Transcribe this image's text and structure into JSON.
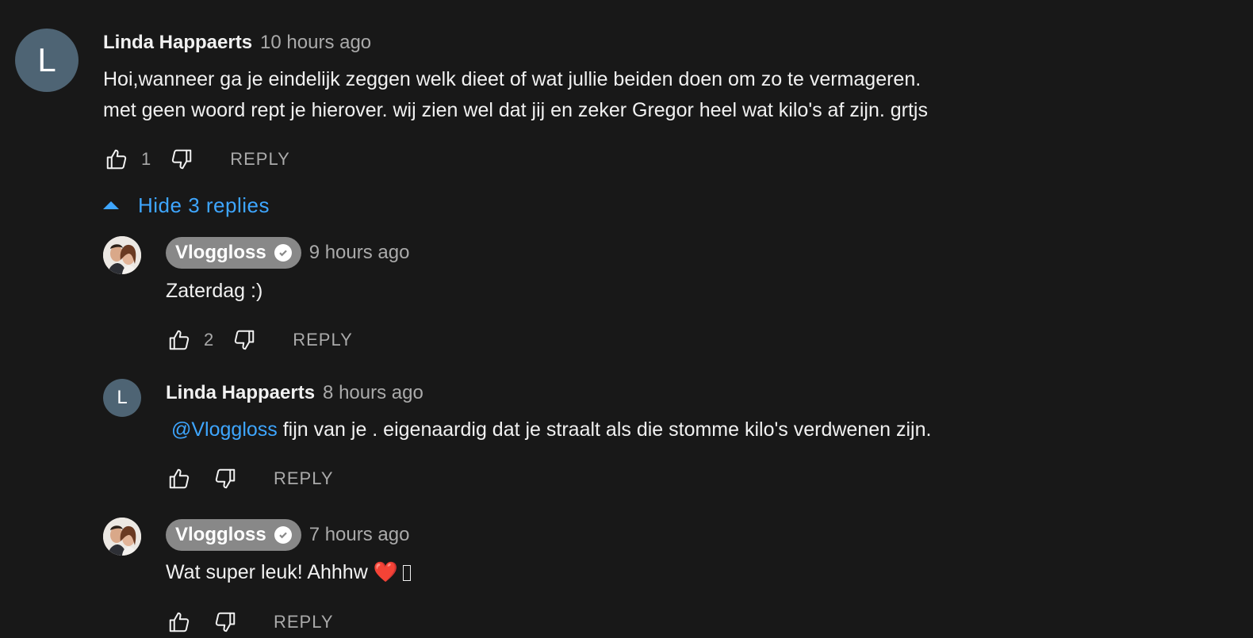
{
  "comments": [
    {
      "avatar_letter": "L",
      "author": "Linda Happaerts",
      "time": "10 hours ago",
      "lines": [
        "Hoi,wanneer ga je eindelijk zeggen welk dieet of wat  jullie beiden doen om zo te vermageren.",
        "met geen woord rept je hierover. wij zien wel dat jij en zeker Gregor heel wat kilo's  af zijn.  grtjs"
      ],
      "likes": "1",
      "reply_label": "REPLY"
    }
  ],
  "replies_toggle": "Hide 3 replies",
  "replies": [
    {
      "author": "Vloggloss",
      "time": "9 hours ago",
      "text": "Zaterdag :)",
      "likes": "2",
      "reply_label": "REPLY"
    },
    {
      "avatar_letter": "L",
      "author": "Linda Happaerts",
      "time": "8 hours ago",
      "mention": "@Vloggloss",
      "text": " fijn van je . eigenaardig dat je straalt als die stomme kilo's verdwenen zijn.",
      "reply_label": "REPLY"
    },
    {
      "author": "Vloggloss",
      "time": "7 hours ago",
      "text": "Wat super leuk! Ahhhw ❤️",
      "reply_label": "REPLY"
    }
  ],
  "icons": {
    "like": "thumbs-up-icon",
    "dislike": "thumbs-down-icon",
    "verified": "check-circle-icon",
    "toggle": "caret-up-icon"
  },
  "colors": {
    "background": "#181818",
    "link": "#3ea6ff",
    "avatar": "#4e6474",
    "badge": "#888888"
  }
}
